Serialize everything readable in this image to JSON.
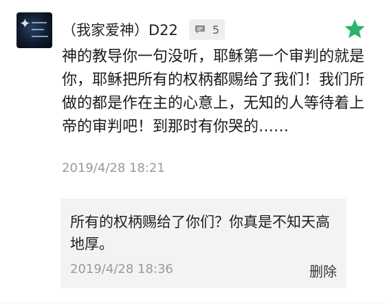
{
  "comment": {
    "username": "（我家爱神）D22",
    "reply_count": "5",
    "text": "神的教导你一句没听，耶稣第一个审判的就是你，耶稣把所有的权柄都赐给了我们！我们所做的都是作在主的心意上，无知的人等待着上帝的审判吧！到那时有你哭的……",
    "timestamp": "2019/4/28 18:21",
    "icons": {
      "reply": "comment-icon",
      "favorite": "star-icon"
    }
  },
  "reply": {
    "text": "所有的权柄赐给了你们？你真是不知天高地厚。",
    "timestamp": "2019/4/28 18:36",
    "delete_label": "删除"
  },
  "colors": {
    "star": "#2db36b",
    "timestamp": "#9a9a9a",
    "reply_background": "#f3f3f3"
  }
}
